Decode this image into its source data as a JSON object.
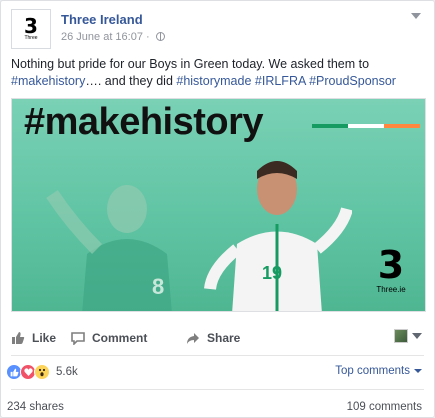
{
  "post": {
    "page_name": "Three Ireland",
    "avatar_logo": "3",
    "avatar_logo_sub": "Three",
    "timestamp": "26 June at 16:07",
    "separator": "·",
    "text_plain_1": "Nothing but pride for our Boys in Green today. We asked them to",
    "tag_1": "#makehistory",
    "text_plain_2": "…. and they did ",
    "tag_2": "#historymade",
    "tag_3": "#IRLFRA",
    "tag_4": "#ProudSponsor"
  },
  "image": {
    "headline": "#makehistory",
    "brand_glyph": "3",
    "brand_site": "Three.ie",
    "jersey_number": "19",
    "jersey_number_bg": "8",
    "tricolour": [
      "#169b62",
      "#ffffff",
      "#ff883e"
    ],
    "background_color": "#5ec3a2"
  },
  "actions": {
    "like_label": "Like",
    "comment_label": "Comment",
    "share_label": "Share"
  },
  "stats": {
    "reaction_count": "5.6k",
    "top_comments_label": "Top comments",
    "shares_label": "234 shares",
    "comments_label": "109 comments",
    "reaction_icons": [
      "like-icon",
      "love-icon",
      "wow-icon"
    ]
  },
  "colors": {
    "link": "#365899",
    "like_blue": "#5890ff",
    "love_red": "#f25268",
    "wow_yellow": "#fcd45a"
  }
}
